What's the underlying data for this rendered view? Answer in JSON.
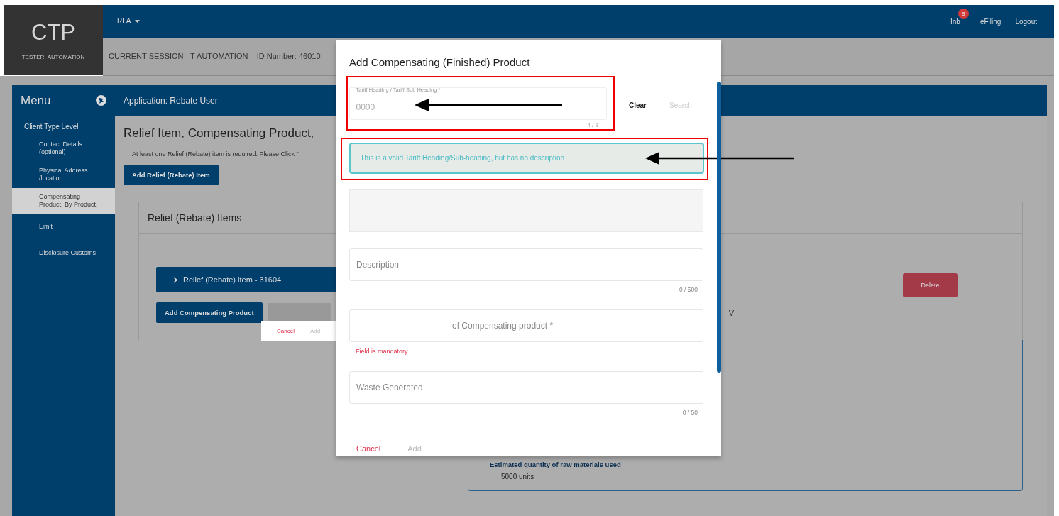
{
  "header": {
    "logo": "CTP",
    "user": "TESTER_AUTOMATION",
    "menu": "RLA",
    "links": [
      {
        "label": "Inb",
        "badge": "9"
      },
      {
        "label": "eFiling"
      },
      {
        "label": "Logout"
      }
    ],
    "session": "CURRENT SESSION - T AUTOMATION – ID Number: 46010"
  },
  "sidebar": {
    "title": "Menu",
    "items": [
      {
        "label": "Client Type Level",
        "selected": false,
        "children": [
          {
            "label": "Contact Details (optional)",
            "selected": false
          },
          {
            "label": "Physical Address /location",
            "selected": false
          },
          {
            "label": "Compensating Product, By Product,",
            "selected": true
          },
          {
            "label": "Limit",
            "selected": false
          },
          {
            "label": "Disclosure Customs",
            "selected": false
          }
        ]
      }
    ]
  },
  "content": {
    "bar_title": "Application: Rebate User",
    "heading": "Relief Item, Compensating Product,",
    "instruction": "At least one Relief (Rebate) item is required. Please Click \"",
    "add_relief_button": "Add Relief (Rebate) Item",
    "card_title": "Relief (Rebate) Items",
    "item": {
      "label": "Relief (Rebate) item - 31604",
      "expanded": false
    },
    "delete_button": "Delete",
    "add_compensating_button": "Add Compensating Product",
    "stray_text": "V",
    "detail_label": "Estimated quantity of raw materials used",
    "detail_value": "5000 units"
  },
  "stray_actions": [
    {
      "label": "Cancel",
      "disabled": false
    },
    {
      "label": "Add",
      "disabled": true
    }
  ],
  "modal": {
    "title": "Add Compensating (Finished) Product",
    "tariff_field": {
      "label": "Tariff Heading / Tariff Sub Heading *",
      "value": "0000",
      "counter": "4 / 8"
    },
    "buttons": [
      {
        "label": "Clear",
        "disabled": false
      },
      {
        "label": "Search",
        "disabled": true
      }
    ],
    "notice": "This is a valid Tariff Heading/Sub-heading, but has no description",
    "fields": [
      {
        "placeholder": "Description",
        "counter": "0 / 500"
      },
      {
        "placeholder": "of Compensating product *",
        "error": "Field is mandatory"
      },
      {
        "placeholder": "Waste Generated",
        "counter": "0 / 50"
      }
    ],
    "actions": [
      {
        "label": "Cancel",
        "disabled": false
      },
      {
        "label": "Add",
        "disabled": true
      }
    ]
  }
}
